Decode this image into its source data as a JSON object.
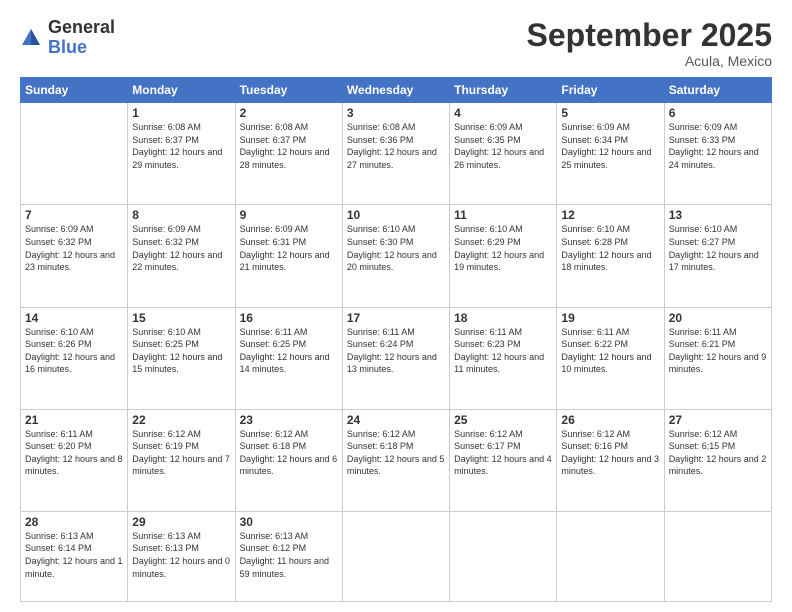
{
  "logo": {
    "general": "General",
    "blue": "Blue"
  },
  "header": {
    "month": "September 2025",
    "location": "Acula, Mexico"
  },
  "days_of_week": [
    "Sunday",
    "Monday",
    "Tuesday",
    "Wednesday",
    "Thursday",
    "Friday",
    "Saturday"
  ],
  "weeks": [
    [
      {
        "num": "",
        "sunrise": "",
        "sunset": "",
        "daylight": ""
      },
      {
        "num": "1",
        "sunrise": "Sunrise: 6:08 AM",
        "sunset": "Sunset: 6:37 PM",
        "daylight": "Daylight: 12 hours and 29 minutes."
      },
      {
        "num": "2",
        "sunrise": "Sunrise: 6:08 AM",
        "sunset": "Sunset: 6:37 PM",
        "daylight": "Daylight: 12 hours and 28 minutes."
      },
      {
        "num": "3",
        "sunrise": "Sunrise: 6:08 AM",
        "sunset": "Sunset: 6:36 PM",
        "daylight": "Daylight: 12 hours and 27 minutes."
      },
      {
        "num": "4",
        "sunrise": "Sunrise: 6:09 AM",
        "sunset": "Sunset: 6:35 PM",
        "daylight": "Daylight: 12 hours and 26 minutes."
      },
      {
        "num": "5",
        "sunrise": "Sunrise: 6:09 AM",
        "sunset": "Sunset: 6:34 PM",
        "daylight": "Daylight: 12 hours and 25 minutes."
      },
      {
        "num": "6",
        "sunrise": "Sunrise: 6:09 AM",
        "sunset": "Sunset: 6:33 PM",
        "daylight": "Daylight: 12 hours and 24 minutes."
      }
    ],
    [
      {
        "num": "7",
        "sunrise": "Sunrise: 6:09 AM",
        "sunset": "Sunset: 6:32 PM",
        "daylight": "Daylight: 12 hours and 23 minutes."
      },
      {
        "num": "8",
        "sunrise": "Sunrise: 6:09 AM",
        "sunset": "Sunset: 6:32 PM",
        "daylight": "Daylight: 12 hours and 22 minutes."
      },
      {
        "num": "9",
        "sunrise": "Sunrise: 6:09 AM",
        "sunset": "Sunset: 6:31 PM",
        "daylight": "Daylight: 12 hours and 21 minutes."
      },
      {
        "num": "10",
        "sunrise": "Sunrise: 6:10 AM",
        "sunset": "Sunset: 6:30 PM",
        "daylight": "Daylight: 12 hours and 20 minutes."
      },
      {
        "num": "11",
        "sunrise": "Sunrise: 6:10 AM",
        "sunset": "Sunset: 6:29 PM",
        "daylight": "Daylight: 12 hours and 19 minutes."
      },
      {
        "num": "12",
        "sunrise": "Sunrise: 6:10 AM",
        "sunset": "Sunset: 6:28 PM",
        "daylight": "Daylight: 12 hours and 18 minutes."
      },
      {
        "num": "13",
        "sunrise": "Sunrise: 6:10 AM",
        "sunset": "Sunset: 6:27 PM",
        "daylight": "Daylight: 12 hours and 17 minutes."
      }
    ],
    [
      {
        "num": "14",
        "sunrise": "Sunrise: 6:10 AM",
        "sunset": "Sunset: 6:26 PM",
        "daylight": "Daylight: 12 hours and 16 minutes."
      },
      {
        "num": "15",
        "sunrise": "Sunrise: 6:10 AM",
        "sunset": "Sunset: 6:25 PM",
        "daylight": "Daylight: 12 hours and 15 minutes."
      },
      {
        "num": "16",
        "sunrise": "Sunrise: 6:11 AM",
        "sunset": "Sunset: 6:25 PM",
        "daylight": "Daylight: 12 hours and 14 minutes."
      },
      {
        "num": "17",
        "sunrise": "Sunrise: 6:11 AM",
        "sunset": "Sunset: 6:24 PM",
        "daylight": "Daylight: 12 hours and 13 minutes."
      },
      {
        "num": "18",
        "sunrise": "Sunrise: 6:11 AM",
        "sunset": "Sunset: 6:23 PM",
        "daylight": "Daylight: 12 hours and 11 minutes."
      },
      {
        "num": "19",
        "sunrise": "Sunrise: 6:11 AM",
        "sunset": "Sunset: 6:22 PM",
        "daylight": "Daylight: 12 hours and 10 minutes."
      },
      {
        "num": "20",
        "sunrise": "Sunrise: 6:11 AM",
        "sunset": "Sunset: 6:21 PM",
        "daylight": "Daylight: 12 hours and 9 minutes."
      }
    ],
    [
      {
        "num": "21",
        "sunrise": "Sunrise: 6:11 AM",
        "sunset": "Sunset: 6:20 PM",
        "daylight": "Daylight: 12 hours and 8 minutes."
      },
      {
        "num": "22",
        "sunrise": "Sunrise: 6:12 AM",
        "sunset": "Sunset: 6:19 PM",
        "daylight": "Daylight: 12 hours and 7 minutes."
      },
      {
        "num": "23",
        "sunrise": "Sunrise: 6:12 AM",
        "sunset": "Sunset: 6:18 PM",
        "daylight": "Daylight: 12 hours and 6 minutes."
      },
      {
        "num": "24",
        "sunrise": "Sunrise: 6:12 AM",
        "sunset": "Sunset: 6:18 PM",
        "daylight": "Daylight: 12 hours and 5 minutes."
      },
      {
        "num": "25",
        "sunrise": "Sunrise: 6:12 AM",
        "sunset": "Sunset: 6:17 PM",
        "daylight": "Daylight: 12 hours and 4 minutes."
      },
      {
        "num": "26",
        "sunrise": "Sunrise: 6:12 AM",
        "sunset": "Sunset: 6:16 PM",
        "daylight": "Daylight: 12 hours and 3 minutes."
      },
      {
        "num": "27",
        "sunrise": "Sunrise: 6:12 AM",
        "sunset": "Sunset: 6:15 PM",
        "daylight": "Daylight: 12 hours and 2 minutes."
      }
    ],
    [
      {
        "num": "28",
        "sunrise": "Sunrise: 6:13 AM",
        "sunset": "Sunset: 6:14 PM",
        "daylight": "Daylight: 12 hours and 1 minute."
      },
      {
        "num": "29",
        "sunrise": "Sunrise: 6:13 AM",
        "sunset": "Sunset: 6:13 PM",
        "daylight": "Daylight: 12 hours and 0 minutes."
      },
      {
        "num": "30",
        "sunrise": "Sunrise: 6:13 AM",
        "sunset": "Sunset: 6:12 PM",
        "daylight": "Daylight: 11 hours and 59 minutes."
      },
      {
        "num": "",
        "sunrise": "",
        "sunset": "",
        "daylight": ""
      },
      {
        "num": "",
        "sunrise": "",
        "sunset": "",
        "daylight": ""
      },
      {
        "num": "",
        "sunrise": "",
        "sunset": "",
        "daylight": ""
      },
      {
        "num": "",
        "sunrise": "",
        "sunset": "",
        "daylight": ""
      }
    ]
  ]
}
